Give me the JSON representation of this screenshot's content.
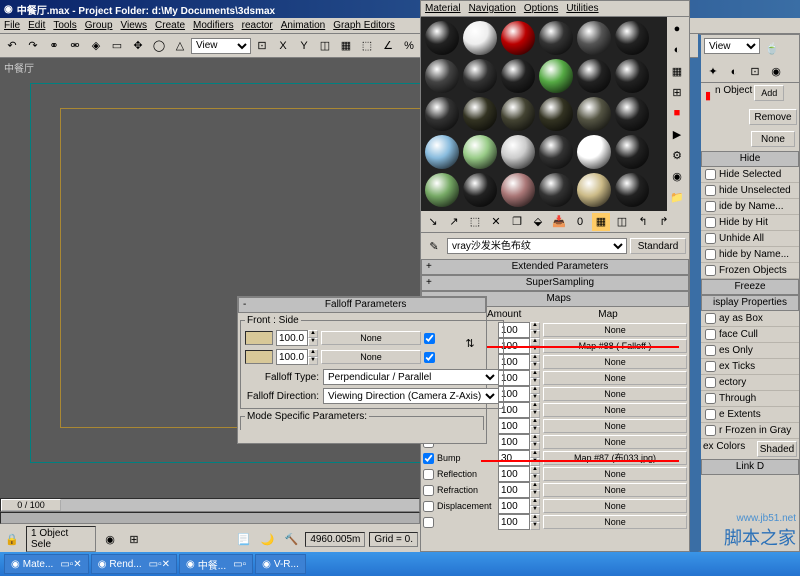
{
  "title": "中餐厅.max  - Project Folder: d:\\My Documents\\3dsmax",
  "mainmenu": [
    "File",
    "Edit",
    "Tools",
    "Group",
    "Views",
    "Create",
    "Modifiers",
    "reactor",
    "Animation",
    "Graph Editors"
  ],
  "matmenu": [
    "Material",
    "Navigation",
    "Options",
    "Utilities"
  ],
  "viewdrop": "View",
  "viewportLabel": "中餐厅",
  "matname": "vray沙发米色布纹",
  "mattype": "Standard",
  "rollouts": {
    "ext": "Extended Parameters",
    "ss": "SuperSampling",
    "maps": "Maps",
    "amount": "Amount",
    "map": "Map"
  },
  "falloff": {
    "title": "Falloff Parameters",
    "frontside": "Front : Side",
    "val1": "100.0",
    "val2": "100.0",
    "none": "None",
    "typeLbl": "Falloff Type:",
    "type": "Perpendicular / Parallel",
    "dirLbl": "Falloff Direction:",
    "dir": "Viewing Direction (Camera Z-Axis)",
    "mode": "Mode Specific Parameters:"
  },
  "maps": [
    {
      "lbl": "",
      "amt": "100",
      "map": "None"
    },
    {
      "lbl": "",
      "amt": "100",
      "map": "Map #88 ( Falloff )"
    },
    {
      "lbl": "",
      "amt": "100",
      "map": "None"
    },
    {
      "lbl": "",
      "amt": "100",
      "map": "None"
    },
    {
      "lbl": "",
      "amt": "100",
      "map": "None"
    },
    {
      "lbl": "",
      "amt": "100",
      "map": "None"
    },
    {
      "lbl": "",
      "amt": "100",
      "map": "None"
    },
    {
      "lbl": "",
      "amt": "100",
      "map": "None"
    },
    {
      "lbl": "Bump",
      "amt": "30",
      "map": "Map #87 (布033.jpg)"
    },
    {
      "lbl": "Reflection",
      "amt": "100",
      "map": "None"
    },
    {
      "lbl": "Refraction",
      "amt": "100",
      "map": "None"
    },
    {
      "lbl": "Displacement",
      "amt": "100",
      "map": "None"
    },
    {
      "lbl": "",
      "amt": "100",
      "map": "None"
    }
  ],
  "cmdpanel": {
    "view": "View",
    "nobj": "n Object",
    "add": "Add",
    "remove": "Remove",
    "none": "None",
    "items": [
      "Hide",
      "Hide Selected",
      "hide Unselected",
      "ide by Name...",
      "Hide by Hit",
      "Unhide All",
      "hide by Name...",
      "Frozen Objects",
      "Freeze",
      "isplay Properties",
      "ay as Box",
      "face Cull",
      "es Only",
      "ex Ticks",
      "ectory",
      "Through",
      "e Extents",
      "r Frozen in Gray"
    ],
    "vxColors": "ex Colors",
    "shaded": "Shaded",
    "linkd": "Link D"
  },
  "timeline": {
    "range": "0 / 100",
    "obj": "1 Object Sele",
    "coord": "4960.005m",
    "grid": "Grid = 0."
  },
  "taskbar": [
    "Mate...",
    "Rend...",
    "中餐...",
    "V-R..."
  ],
  "watermark": {
    "url": "www.jb51.net",
    "txt": "脚本之家"
  },
  "swatches": [
    [
      "#222",
      "#eee",
      "#b00",
      "#333",
      "#555",
      "#222"
    ],
    [
      "#444",
      "#333",
      "#222",
      "#5a4",
      "#222",
      "#222"
    ],
    [
      "#333",
      "#332",
      "#443",
      "#332",
      "#554",
      "#222"
    ],
    [
      "#8bd",
      "#9c8",
      "#ccc",
      "#333",
      "#fff",
      "#222"
    ],
    [
      "#7a6",
      "#222",
      "#a77",
      "#333",
      "#cb8",
      "#222"
    ]
  ]
}
